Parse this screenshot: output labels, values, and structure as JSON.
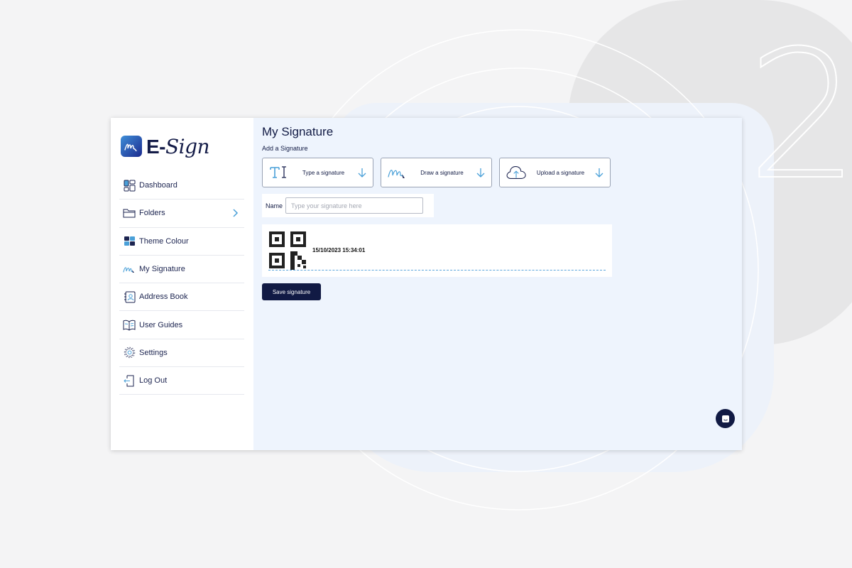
{
  "decor": {
    "step_number": "2"
  },
  "app": {
    "logo": {
      "text_prefix": "E-",
      "text_suffix": "Sign",
      "icon": "signature-logo-icon"
    },
    "sidebar": {
      "items": [
        {
          "label": "Dashboard",
          "icon": "dashboard-icon"
        },
        {
          "label": "Folders",
          "icon": "folder-icon",
          "has_chevron": true
        },
        {
          "label": "Theme Colour",
          "icon": "palette-icon"
        },
        {
          "label": "My Signature",
          "icon": "signature-icon",
          "active": true
        },
        {
          "label": "Address Book",
          "icon": "address-book-icon"
        },
        {
          "label": "User Guides",
          "icon": "book-icon"
        },
        {
          "label": "Settings",
          "icon": "gear-icon"
        },
        {
          "label": "Log Out",
          "icon": "logout-icon"
        }
      ]
    },
    "main": {
      "title": "My Signature",
      "subtitle": "Add a Signature",
      "options": [
        {
          "label": "Type a signature",
          "icon": "type-text-icon"
        },
        {
          "label": "Draw a signature",
          "icon": "draw-signature-icon"
        },
        {
          "label": "Upload a signature",
          "icon": "cloud-upload-icon"
        }
      ],
      "name_field": {
        "label": "Name",
        "placeholder": "Type your signature here",
        "value": ""
      },
      "preview": {
        "timestamp": "15/10/2023 15:34:01",
        "qr_icon": "qr-code-icon"
      },
      "save_label": "Save signature",
      "chat_icon": "chat-icon"
    }
  },
  "colors": {
    "primary": "#111a44",
    "accent": "#5aa4dc",
    "content_bg": "#eef4fd"
  }
}
